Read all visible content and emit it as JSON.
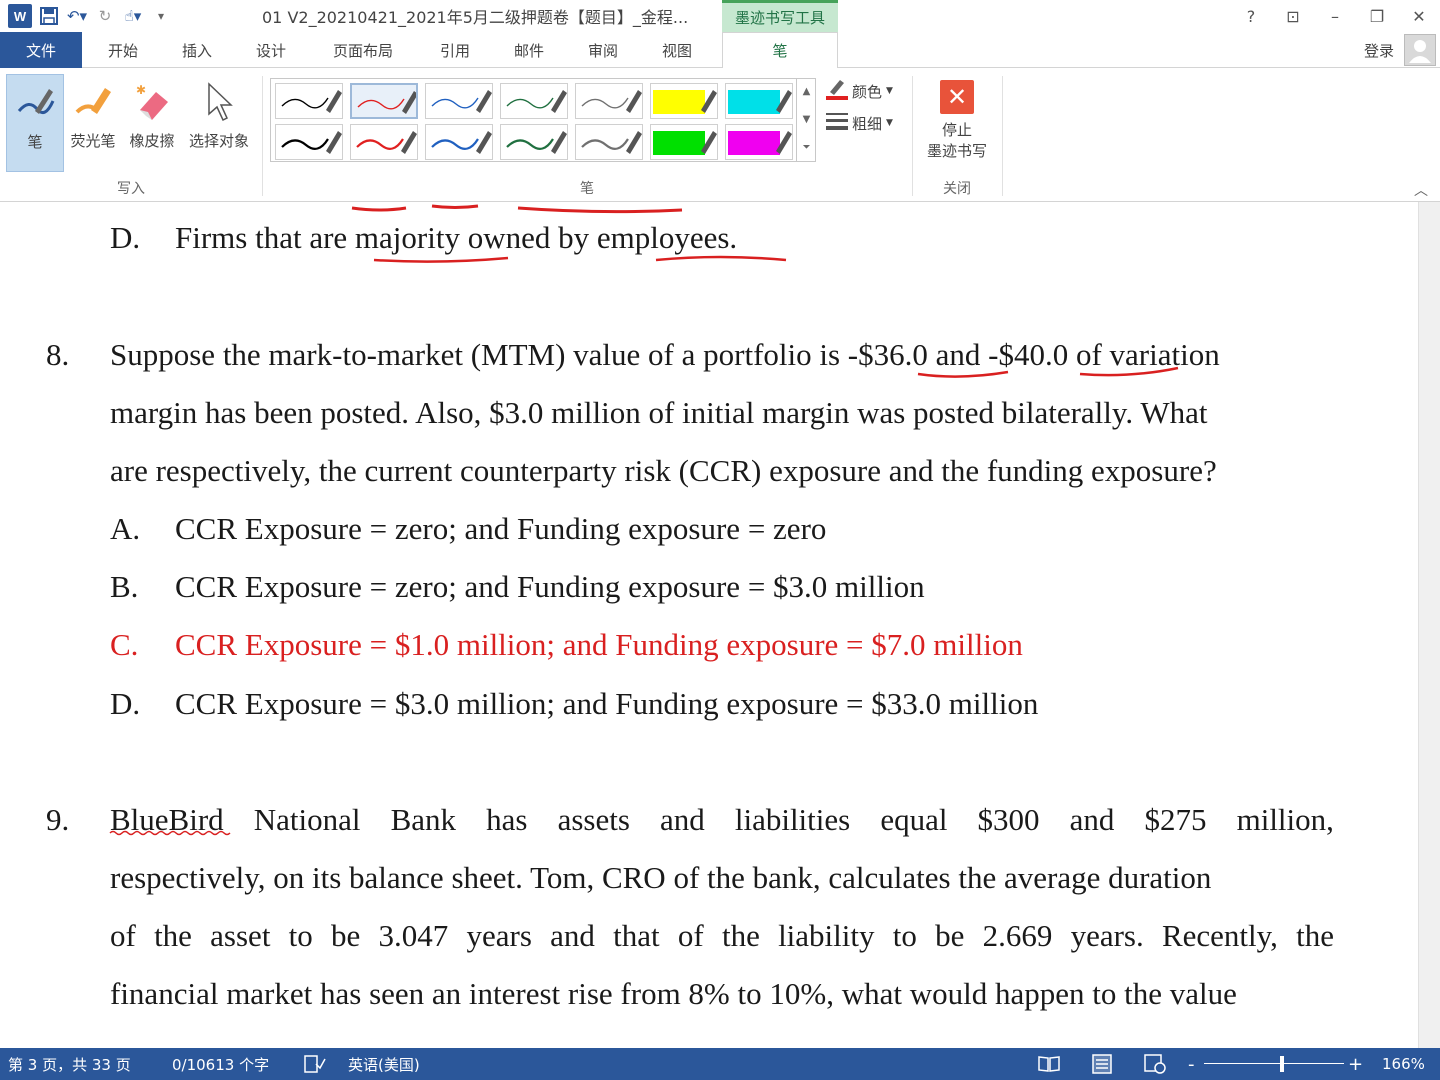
{
  "titlebar": {
    "doc_title": "01 V2_20210421_2021年5月二级押题卷【题目】_金程...",
    "context_tab": "墨迹书写工具",
    "help": "?",
    "ribbon_display": "⊡",
    "minimize": "–",
    "restore": "❐",
    "close": "✕"
  },
  "tabs": {
    "file": "文件",
    "home": "开始",
    "insert": "插入",
    "design": "设计",
    "layout": "页面布局",
    "references": "引用",
    "mailings": "邮件",
    "review": "审阅",
    "view": "视图",
    "pens": "笔",
    "login": "登录"
  },
  "ribbon": {
    "write_group": {
      "label": "写入",
      "pen": "笔",
      "highlighter": "荧光笔",
      "eraser": "橡皮擦",
      "select": "选择对象"
    },
    "pens_group": {
      "label": "笔",
      "color": "颜色",
      "thickness": "粗细"
    },
    "close_group": {
      "label": "关闭",
      "stop_line1": "停止",
      "stop_line2": "墨迹书写"
    },
    "pen_colors": [
      "#000000",
      "#e02020",
      "#2060c0",
      "#207040",
      "#707070",
      "#ffff00",
      "#00e0e8",
      "#000000",
      "#e02020",
      "#2060c0",
      "#207040",
      "#707070",
      "#00e000",
      "#f000f0"
    ]
  },
  "document": {
    "prev_option": {
      "letter": "D.",
      "text": "Firms that are majority owned by employees."
    },
    "q8": {
      "number": "8.",
      "line1": "Suppose the mark-to-market (MTM) value of a portfolio is -$36.0 and -$40.0 of variation",
      "line2": "margin has been posted. Also, $3.0 million of initial margin was posted bilaterally. What",
      "line3": "are respectively, the current counterparty risk (CCR) exposure and the funding exposure?",
      "options": [
        {
          "letter": "A.",
          "text": "CCR Exposure = zero; and Funding exposure = zero"
        },
        {
          "letter": "B.",
          "text": "CCR Exposure = zero; and Funding exposure = $3.0 million"
        },
        {
          "letter": "C.",
          "text": "CCR Exposure = $1.0 million; and Funding exposure = $7.0 million"
        },
        {
          "letter": "D.",
          "text": "CCR Exposure = $3.0 million; and Funding exposure = $33.0 million"
        }
      ]
    },
    "q9": {
      "number": "9.",
      "line1_words": [
        "BlueBird",
        "National",
        "Bank",
        "has",
        "assets",
        "and",
        "liabilities",
        "equal",
        "$300",
        "and",
        "$275",
        "million,"
      ],
      "line2": "respectively, on its balance sheet. Tom, CRO of the bank, calculates the average duration",
      "line3_words": [
        "of",
        "the",
        "asset",
        "to",
        "be",
        "3.047",
        "years",
        "and",
        "that",
        "of",
        "the",
        "liability",
        "to",
        "be",
        "2.669",
        "years.",
        "Recently,",
        "the"
      ],
      "line4": "financial market has seen an interest rise from 8% to 10%, what would happen to the value"
    }
  },
  "status": {
    "page": "第 3 页，共 33 页",
    "words": "0/10613 个字",
    "proof_icon": "proofing-icon",
    "language": "英语(美国)",
    "zoom": "166%",
    "zoom_minus": "-",
    "zoom_plus": "+"
  }
}
